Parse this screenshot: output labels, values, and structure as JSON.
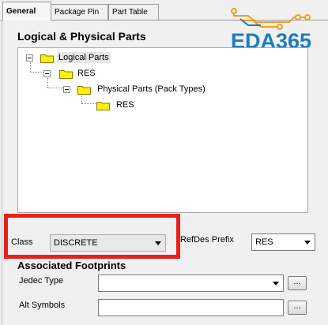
{
  "tabs": [
    {
      "label": "General",
      "active": true
    },
    {
      "label": "Package Pin",
      "active": false
    },
    {
      "label": "Part Table",
      "active": false
    }
  ],
  "logo": {
    "text": "EDA365",
    "color": "#1b7dc0",
    "circuit_color": "#e8a020"
  },
  "parts_group": {
    "title": "Logical & Physical Parts",
    "tree": [
      {
        "label": "Logical Parts",
        "icon": "folder-icon",
        "expanded": true,
        "selected": true
      },
      {
        "label": "RES",
        "icon": "folder-icon",
        "expanded": true
      },
      {
        "label": "Physical Parts (Pack Types)",
        "icon": "folder-icon",
        "expanded": true
      },
      {
        "label": "RES",
        "icon": "folder-icon"
      }
    ]
  },
  "class_field": {
    "label": "Class",
    "value": "DISCRETE"
  },
  "refdes_field": {
    "label": "RefDes Prefix",
    "value": "RES"
  },
  "footprints_group": {
    "title": "Associated Footprints",
    "jedec_label": "Jedec Type",
    "jedec_value": "",
    "jedec_browse": "...",
    "alt_label": "Alt Symbols",
    "alt_value": "",
    "alt_browse": "..."
  },
  "annotation": {
    "color": "#e8201c"
  }
}
